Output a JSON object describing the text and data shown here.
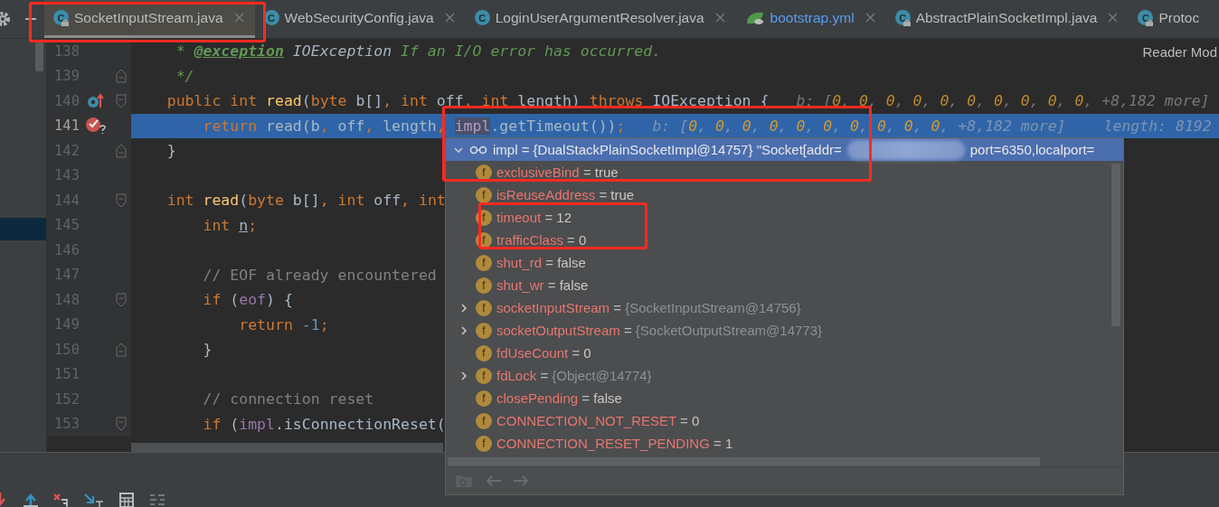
{
  "tabs": [
    {
      "label": "SocketInputStream.java",
      "selected": true,
      "kind": "java",
      "badge": "C",
      "locked": true
    },
    {
      "label": "WebSecurityConfig.java",
      "selected": false,
      "kind": "java",
      "badge": "C",
      "locked": false
    },
    {
      "label": "LoginUserArgumentResolver.java",
      "selected": false,
      "kind": "java",
      "badge": "C",
      "locked": false
    },
    {
      "label": "bootstrap.yml",
      "selected": false,
      "kind": "yml",
      "locked": false
    },
    {
      "label": "AbstractPlainSocketImpl.java",
      "selected": false,
      "kind": "java",
      "badge": "C",
      "locked": true
    },
    {
      "label": "Protoc",
      "selected": false,
      "kind": "java",
      "badge": "C",
      "locked": true
    }
  ],
  "reader_mode": "Reader Mod",
  "editor": {
    "lines": [
      {
        "number": "138",
        "current": false,
        "tokens": [
          {
            "text": "     * ",
            "kind": "doc"
          },
          {
            "text": "@exception",
            "kind": "doctag"
          },
          {
            "text": " IOException",
            "kind": "docref"
          },
          {
            "text": " If an I/O error has occurred.",
            "kind": "doc"
          }
        ]
      },
      {
        "number": "139",
        "current": false,
        "fold": {
          "kind": "end"
        },
        "tokens": [
          {
            "text": "     */",
            "kind": "doc"
          }
        ]
      },
      {
        "number": "140",
        "current": false,
        "fold": {
          "kind": "start"
        },
        "marker": {
          "kind": "override"
        },
        "tokens": [
          {
            "text": "    public",
            "kind": "kw"
          },
          {
            "text": " int",
            "kind": "kw"
          },
          {
            "text": " read",
            "kind": "fn"
          },
          {
            "text": "(",
            "kind": "p"
          },
          {
            "text": "byte",
            "kind": "kw"
          },
          {
            "text": " b[]",
            "kind": "p"
          },
          {
            "text": ",",
            "kind": "kw"
          },
          {
            "text": " int",
            "kind": "kw"
          },
          {
            "text": " off",
            "kind": "p"
          },
          {
            "text": ",",
            "kind": "kw"
          },
          {
            "text": " int",
            "kind": "kw"
          },
          {
            "text": " length) ",
            "kind": "p"
          },
          {
            "text": "throws",
            "kind": "kw"
          },
          {
            "text": " IOException {",
            "kind": "p"
          }
        ],
        "hints": [
          {
            "tokens": [
              {
                "text": "b: [",
                "kind": "hint"
              },
              {
                "text": "0",
                "kind": "hintnum"
              },
              {
                "text": ", ",
                "kind": "hint"
              },
              {
                "text": "0",
                "kind": "hintnum"
              },
              {
                "text": ", ",
                "kind": "hint"
              },
              {
                "text": "0",
                "kind": "hintnum"
              },
              {
                "text": ", ",
                "kind": "hint"
              },
              {
                "text": "0",
                "kind": "hintnum"
              },
              {
                "text": ", ",
                "kind": "hint"
              },
              {
                "text": "0",
                "kind": "hintnum"
              },
              {
                "text": ", ",
                "kind": "hint"
              },
              {
                "text": "0",
                "kind": "hintnum"
              },
              {
                "text": ", ",
                "kind": "hint"
              },
              {
                "text": "0",
                "kind": "hintnum"
              },
              {
                "text": ", ",
                "kind": "hint"
              },
              {
                "text": "0",
                "kind": "hintnum"
              },
              {
                "text": ", ",
                "kind": "hint"
              },
              {
                "text": "0",
                "kind": "hintnum"
              },
              {
                "text": ", ",
                "kind": "hint"
              },
              {
                "text": "0",
                "kind": "hintnum"
              },
              {
                "text": ", +8,182 more]",
                "kind": "hint"
              }
            ]
          }
        ]
      },
      {
        "number": "141",
        "current": true,
        "marker": {
          "kind": "breakpoint"
        },
        "tokens": [
          {
            "text": "        return",
            "kind": "kw"
          },
          {
            "text": " read(b",
            "kind": "p"
          },
          {
            "text": ",",
            "kind": "kw"
          },
          {
            "text": " off",
            "kind": "p"
          },
          {
            "text": ",",
            "kind": "kw"
          },
          {
            "text": " length",
            "kind": "p"
          },
          {
            "text": ", ",
            "kind": "kw"
          },
          {
            "text": "impl",
            "kind": "fieldhl"
          },
          {
            "text": ".getTimeout())",
            "kind": "p"
          },
          {
            "text": ";",
            "kind": "kw"
          }
        ],
        "hints": [
          {
            "tokens": [
              {
                "text": "b: [",
                "kind": "hint"
              },
              {
                "text": "0",
                "kind": "hintnum"
              },
              {
                "text": ", ",
                "kind": "hint"
              },
              {
                "text": "0",
                "kind": "hintnum"
              },
              {
                "text": ", ",
                "kind": "hint"
              },
              {
                "text": "0",
                "kind": "hintnum"
              },
              {
                "text": ", ",
                "kind": "hint"
              },
              {
                "text": "0",
                "kind": "hintnum"
              },
              {
                "text": ", ",
                "kind": "hint"
              },
              {
                "text": "0",
                "kind": "hintnum"
              },
              {
                "text": ", ",
                "kind": "hint"
              },
              {
                "text": "0",
                "kind": "hintnum"
              },
              {
                "text": ", ",
                "kind": "hint"
              },
              {
                "text": "0",
                "kind": "hintnum"
              },
              {
                "text": ", ",
                "kind": "hint"
              },
              {
                "text": "0",
                "kind": "hintnum"
              },
              {
                "text": ", ",
                "kind": "hint"
              },
              {
                "text": "0",
                "kind": "hintnum"
              },
              {
                "text": ", ",
                "kind": "hint"
              },
              {
                "text": "0",
                "kind": "hintnum"
              },
              {
                "text": ", +8,182 more]",
                "kind": "hint"
              }
            ]
          },
          {
            "tokens": [
              {
                "text": "length: 8192",
                "kind": "hint"
              }
            ]
          }
        ]
      },
      {
        "number": "142",
        "current": false,
        "fold": {
          "kind": "end"
        },
        "tokens": [
          {
            "text": "    }",
            "kind": "p"
          }
        ]
      },
      {
        "number": "143",
        "current": false
      },
      {
        "number": "144",
        "current": false,
        "fold": {
          "kind": "start"
        },
        "tokens": [
          {
            "text": "    int",
            "kind": "kw"
          },
          {
            "text": " read",
            "kind": "fn"
          },
          {
            "text": "(",
            "kind": "p"
          },
          {
            "text": "byte",
            "kind": "kw"
          },
          {
            "text": " b[]",
            "kind": "p"
          },
          {
            "text": ",",
            "kind": "kw"
          },
          {
            "text": " int",
            "kind": "kw"
          },
          {
            "text": " off",
            "kind": "p"
          },
          {
            "text": ",",
            "kind": "kw"
          },
          {
            "text": " int",
            "kind": "kw"
          }
        ]
      },
      {
        "number": "145",
        "current": false,
        "tokens": [
          {
            "text": "        int ",
            "kind": "kw"
          },
          {
            "text": "n",
            "kind": "var"
          },
          {
            "text": ";",
            "kind": "kw"
          }
        ]
      },
      {
        "number": "146",
        "current": false
      },
      {
        "number": "147",
        "current": false,
        "tokens": [
          {
            "text": "        // EOF already encountered",
            "kind": "cm"
          }
        ]
      },
      {
        "number": "148",
        "current": false,
        "fold": {
          "kind": "start"
        },
        "tokens": [
          {
            "text": "        if",
            "kind": "kw"
          },
          {
            "text": " (",
            "kind": "p"
          },
          {
            "text": "eof",
            "kind": "field"
          },
          {
            "text": ") {",
            "kind": "p"
          }
        ]
      },
      {
        "number": "149",
        "current": false,
        "tokens": [
          {
            "text": "            return ",
            "kind": "kw"
          },
          {
            "text": "-1",
            "kind": "num"
          },
          {
            "text": ";",
            "kind": "kw"
          }
        ]
      },
      {
        "number": "150",
        "current": false,
        "fold": {
          "kind": "end"
        },
        "tokens": [
          {
            "text": "        }",
            "kind": "p"
          }
        ]
      },
      {
        "number": "151",
        "current": false
      },
      {
        "number": "152",
        "current": false,
        "tokens": [
          {
            "text": "        // connection reset",
            "kind": "cm"
          }
        ]
      },
      {
        "number": "153",
        "current": false,
        "fold": {
          "kind": "start"
        },
        "tokens": [
          {
            "text": "        if",
            "kind": "kw"
          },
          {
            "text": " (",
            "kind": "p"
          },
          {
            "text": "impl",
            "kind": "field"
          },
          {
            "text": ".isConnectionReset(",
            "kind": "p"
          }
        ]
      }
    ]
  },
  "popup": {
    "header": {
      "expanded": true,
      "text": "impl = {DualStackPlainSocketImpl@14757} \"Socket[addr=",
      "text_after": "port=6350,localport="
    },
    "rows": [
      {
        "name": "exclusiveBind",
        "operator": "=",
        "value": "true",
        "kind": "primitive",
        "badge": "f"
      },
      {
        "name": "isReuseAddress",
        "operator": "=",
        "value": "true",
        "kind": "primitive",
        "badge": "f"
      },
      {
        "name": "timeout",
        "operator": "=",
        "value": "12",
        "kind": "primitive",
        "badge": "f"
      },
      {
        "name": "trafficClass",
        "operator": "=",
        "value": "0",
        "kind": "primitive",
        "badge": "f"
      },
      {
        "name": "shut_rd",
        "operator": "=",
        "value": "false",
        "kind": "primitive",
        "badge": "f"
      },
      {
        "name": "shut_wr",
        "operator": "=",
        "value": "false",
        "kind": "primitive",
        "badge": "f"
      },
      {
        "name": "socketInputStream",
        "operator": "=",
        "value": "{SocketInputStream@14756}",
        "kind": "object",
        "badge": "f",
        "expanded": false
      },
      {
        "name": "socketOutputStream",
        "operator": "=",
        "value": "{SocketOutputStream@14773}",
        "kind": "object",
        "badge": "f",
        "expanded": false
      },
      {
        "name": "fdUseCount",
        "operator": "=",
        "value": "0",
        "kind": "primitive",
        "badge": "f"
      },
      {
        "name": "fdLock",
        "operator": "=",
        "value": "{Object@14774}",
        "kind": "object",
        "badge": "f",
        "expanded": false
      },
      {
        "name": "closePending",
        "operator": "=",
        "value": "false",
        "kind": "primitive",
        "badge": "f"
      },
      {
        "name": "CONNECTION_NOT_RESET",
        "operator": "=",
        "value": "0",
        "kind": "primitive",
        "badge": "f"
      },
      {
        "name": "CONNECTION_RESET_PENDING",
        "operator": "=",
        "value": "1",
        "kind": "primitive",
        "badge": "f"
      }
    ]
  }
}
